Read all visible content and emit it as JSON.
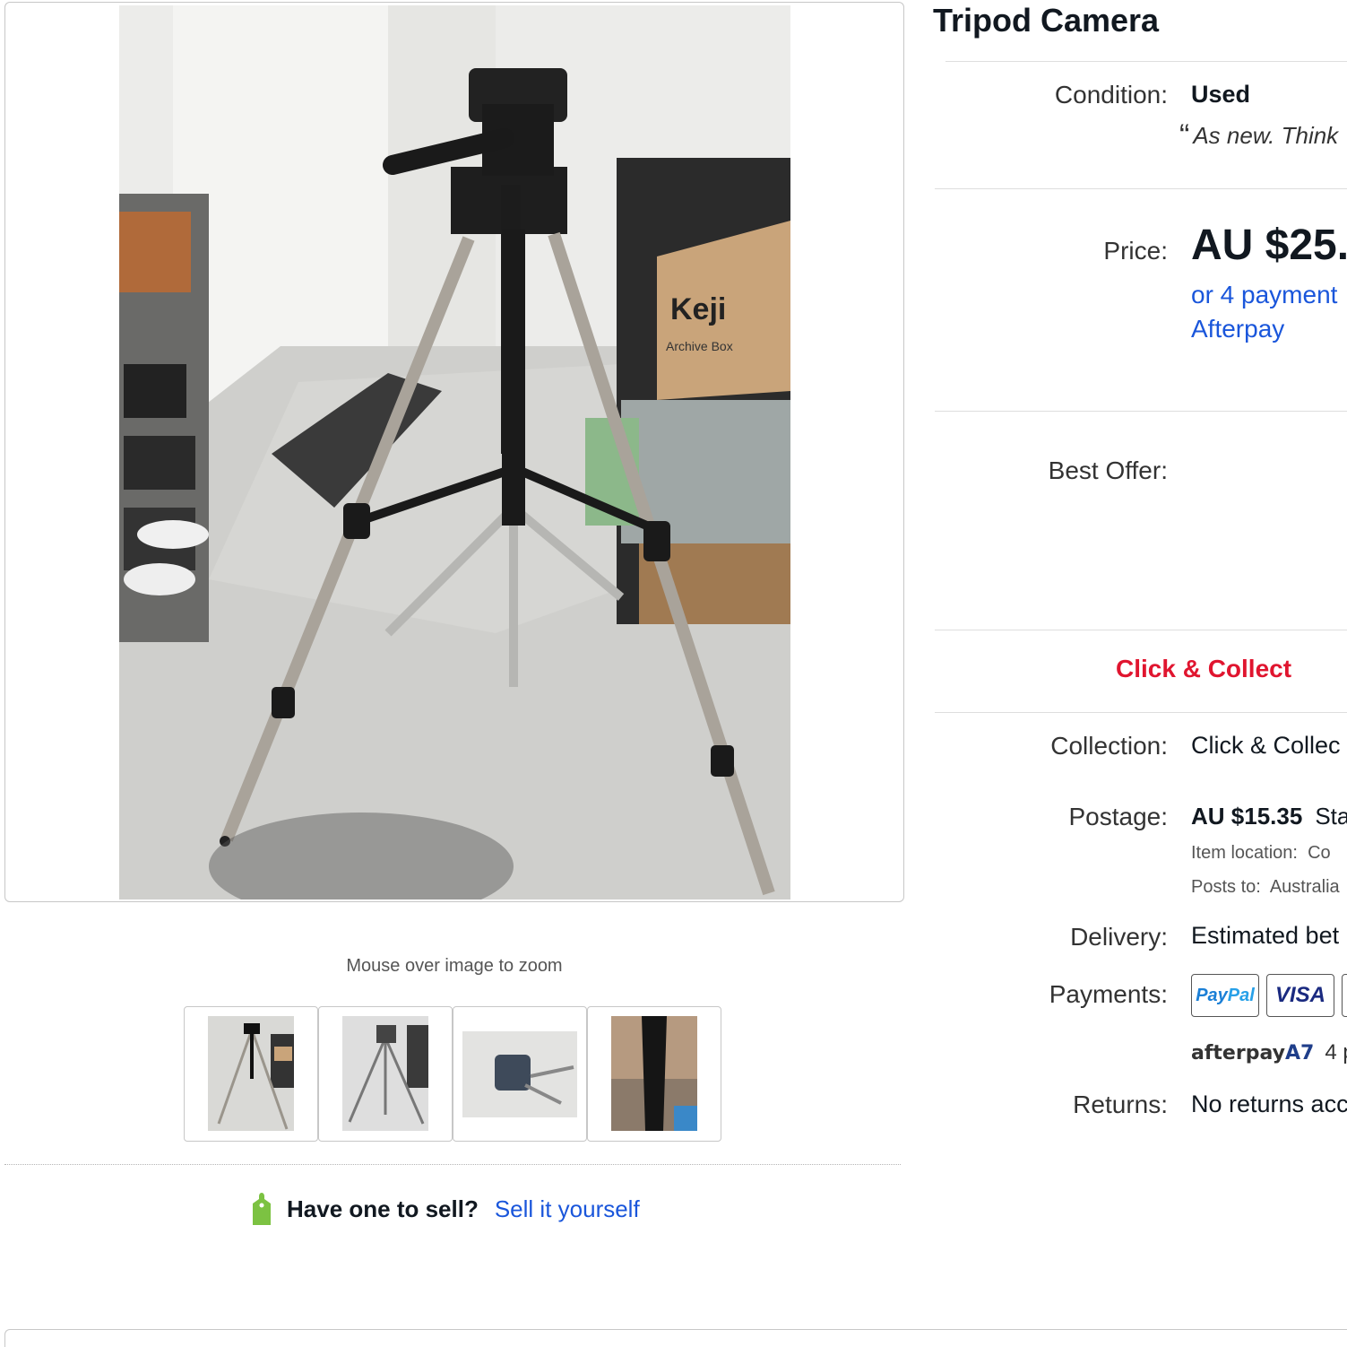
{
  "listing": {
    "title": "Tripod Camera",
    "zoom_hint": "Mouse over image to zoom",
    "thumbnails": [
      {
        "name": "thumbnail-1"
      },
      {
        "name": "thumbnail-2"
      },
      {
        "name": "thumbnail-3"
      },
      {
        "name": "thumbnail-4"
      }
    ],
    "photo_sign_text": {
      "brand": "Keji",
      "caption": "Archive Box"
    }
  },
  "sell": {
    "question": "Have one to sell?",
    "link": "Sell it yourself"
  },
  "details": {
    "condition_label": "Condition:",
    "condition_value": "Used",
    "condition_quote_mark": "“",
    "condition_quote": "As new. Think",
    "price_label": "Price:",
    "price_value": "AU $25.",
    "afterpay_line1": "or 4 payment",
    "afterpay_line2": "Afterpay",
    "best_offer_label": "Best Offer:",
    "click_collect": "Click & Collect",
    "collection_label": "Collection:",
    "collection_value": "Click & Collec",
    "postage_label": "Postage:",
    "postage_price": "AU $15.35",
    "postage_service": "Sta",
    "item_location_label": "Item location:",
    "item_location_value": "Co",
    "posts_to_label": "Posts to:",
    "posts_to_value": "Australia",
    "delivery_label": "Delivery:",
    "delivery_value": "Estimated bet",
    "payments_label": "Payments:",
    "payment_badges": {
      "paypal_1": "Pay",
      "paypal_2": "Pal",
      "visa": "VISA"
    },
    "afterpay_logo_text": "afterpay",
    "afterpay_logo_mark": "A7",
    "afterpay_payments": "4 p",
    "returns_label": "Returns:",
    "returns_value": "No returns acc"
  },
  "colors": {
    "link_blue": "#1a56db",
    "click_collect_red": "#e0152f",
    "text_dark": "#111820",
    "sell_tag_green": "#7cc242"
  },
  "icons": [
    "sell-tag-icon",
    "paypal-logo",
    "visa-logo",
    "afterpay-logo"
  ]
}
